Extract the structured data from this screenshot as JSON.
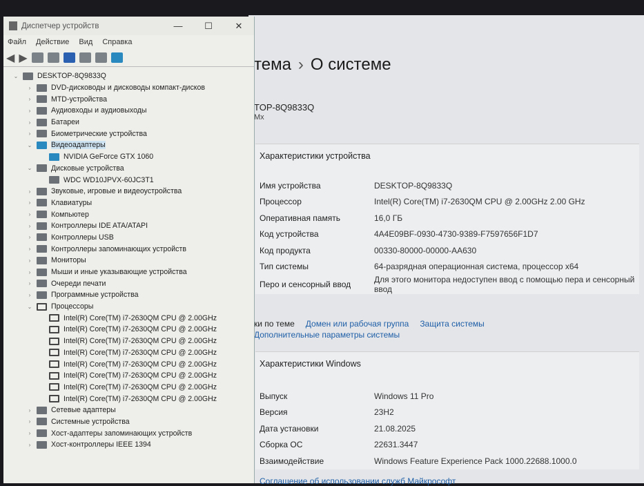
{
  "device_manager": {
    "title": "Диспетчер устройств",
    "controls": {
      "minimize": "—",
      "maximize": "☐",
      "close": "✕"
    },
    "menu": [
      "Файл",
      "Действие",
      "Вид",
      "Справка"
    ],
    "root": "DESKTOP-8Q9833Q",
    "tree": [
      {
        "label": "DVD-дисководы и дисководы компакт-дисков",
        "expanded": false
      },
      {
        "label": "MTD-устройства",
        "expanded": false
      },
      {
        "label": "Аудиовходы и аудиовыходы",
        "expanded": false
      },
      {
        "label": "Батареи",
        "expanded": false
      },
      {
        "label": "Биометрические устройства",
        "expanded": false
      },
      {
        "label": "Видеоадаптеры",
        "expanded": true,
        "selected": true,
        "children": [
          "NVIDIA GeForce GTX 1060"
        ]
      },
      {
        "label": "Дисковые устройства",
        "expanded": true,
        "children": [
          "WDC WD10JPVX-60JC3T1"
        ]
      },
      {
        "label": "Звуковые, игровые и видеоустройства",
        "expanded": false
      },
      {
        "label": "Клавиатуры",
        "expanded": false
      },
      {
        "label": "Компьютер",
        "expanded": false
      },
      {
        "label": "Контроллеры IDE ATA/ATAPI",
        "expanded": false
      },
      {
        "label": "Контроллеры USB",
        "expanded": false
      },
      {
        "label": "Контроллеры запоминающих устройств",
        "expanded": false
      },
      {
        "label": "Мониторы",
        "expanded": false
      },
      {
        "label": "Мыши и иные указывающие устройства",
        "expanded": false
      },
      {
        "label": "Очереди печати",
        "expanded": false
      },
      {
        "label": "Программные устройства",
        "expanded": false
      },
      {
        "label": "Процессоры",
        "expanded": true,
        "children": [
          "Intel(R) Core(TM) i7-2630QM CPU @ 2.00GHz",
          "Intel(R) Core(TM) i7-2630QM CPU @ 2.00GHz",
          "Intel(R) Core(TM) i7-2630QM CPU @ 2.00GHz",
          "Intel(R) Core(TM) i7-2630QM CPU @ 2.00GHz",
          "Intel(R) Core(TM) i7-2630QM CPU @ 2.00GHz",
          "Intel(R) Core(TM) i7-2630QM CPU @ 2.00GHz",
          "Intel(R) Core(TM) i7-2630QM CPU @ 2.00GHz",
          "Intel(R) Core(TM) i7-2630QM CPU @ 2.00GHz"
        ]
      },
      {
        "label": "Сетевые адаптеры",
        "expanded": false
      },
      {
        "label": "Системные устройства",
        "expanded": false
      },
      {
        "label": "Хост-адаптеры запоминающих устройств",
        "expanded": false
      },
      {
        "label": "Хост-контроллеры IEEE 1394",
        "expanded": false
      }
    ]
  },
  "settings": {
    "breadcrumb_parent": "тема",
    "breadcrumb_sep": "›",
    "page_title": "О системе",
    "device_name": "TOP-8Q9833Q",
    "device_sub": "Mx",
    "device_specs": {
      "title": "Характеристики устройства",
      "rows": [
        {
          "k": "Имя устройства",
          "v": "DESKTOP-8Q9833Q"
        },
        {
          "k": "Процессор",
          "v": "Intel(R) Core(TM) i7-2630QM CPU @ 2.00GHz   2.00 GHz"
        },
        {
          "k": "Оперативная память",
          "v": "16,0 ГБ"
        },
        {
          "k": "Код устройства",
          "v": "4A4E09BF-0930-4730-9389-F7597656F1D7"
        },
        {
          "k": "Код продукта",
          "v": "00330-80000-00000-AA630"
        },
        {
          "k": "Тип системы",
          "v": "64-разрядная операционная система, процессор x64"
        },
        {
          "k": "Перо и сенсорный ввод",
          "v": "Для этого монитора недоступен ввод с помощью пера и сенсорный ввод"
        }
      ]
    },
    "related": {
      "label": "ки по теме",
      "links": [
        "Домен или рабочая группа",
        "Защита системы",
        "Дополнительные параметры системы"
      ]
    },
    "windows_specs": {
      "title": "Характеристики Windows",
      "rows": [
        {
          "k": "Выпуск",
          "v": "Windows 11 Pro"
        },
        {
          "k": "Версия",
          "v": "23H2"
        },
        {
          "k": "Дата установки",
          "v": "21.08.2025"
        },
        {
          "k": "Сборка ОС",
          "v": "22631.3447"
        },
        {
          "k": "Взаимодействие",
          "v": "Windows Feature Experience Pack 1000.22688.1000.0"
        }
      ]
    },
    "footer_link": "Соглашение об использовании служб Майкрософт"
  }
}
